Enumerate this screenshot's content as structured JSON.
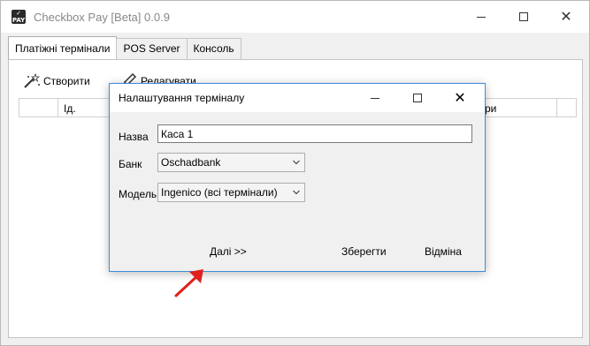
{
  "window": {
    "title": "Checkbox Pay [Beta] 0.0.9"
  },
  "tabs": [
    {
      "label": "Платіжні термінали",
      "active": true
    },
    {
      "label": "POS Server",
      "active": false
    },
    {
      "label": "Консоль",
      "active": false
    }
  ],
  "toolbar": {
    "create_label": "Створити",
    "edit_label": "Редагувати"
  },
  "grid": {
    "columns": [
      "",
      "Ід.",
      "ри"
    ]
  },
  "dialog": {
    "title": "Налаштування терміналу",
    "name_label": "Назва",
    "name_value": "Каса 1",
    "bank_label": "Банк",
    "bank_value": "Oschadbank",
    "model_label": "Модель",
    "model_value": "Ingenico (всі термінали)",
    "next_label": "Далі >>",
    "save_label": "Зберегти",
    "cancel_label": "Відміна"
  },
  "colors": {
    "dialog_border": "#3a8dd8",
    "annotation_arrow": "#e0201c"
  }
}
